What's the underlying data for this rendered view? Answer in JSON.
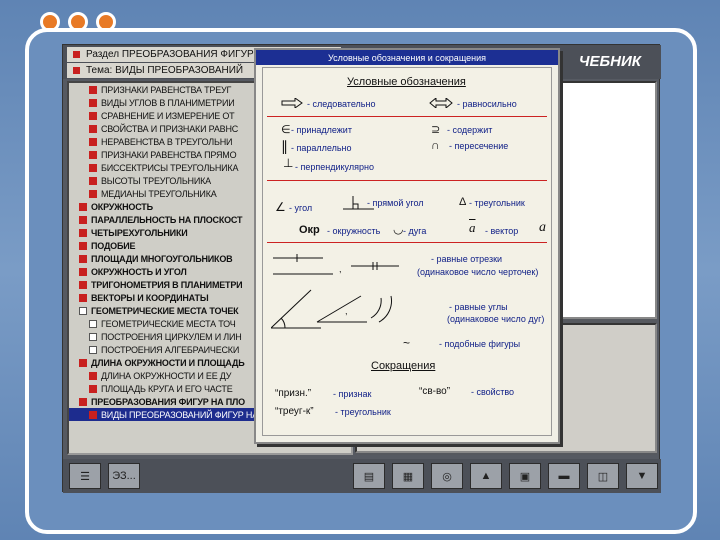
{
  "top": {
    "section_line": "Раздел ПРЕОБРАЗОВАНИЯ ФИГУР",
    "topic_line": "Тема:  ВИДЫ ПРЕОБРАЗОВАНИЙ",
    "title_right": "ЧЕБНИК"
  },
  "tree": [
    {
      "label": "ПРИЗНАКИ РАВЕНСТВА ТРЕУГ",
      "level": 1,
      "box": "red"
    },
    {
      "label": "ВИДЫ УГЛОВ В ПЛАНИМЕТРИИ",
      "level": 1,
      "box": "red"
    },
    {
      "label": "СРАВНЕНИЕ И ИЗМЕРЕНИЕ ОТ",
      "level": 1,
      "box": "red"
    },
    {
      "label": "СВОЙСТВА И ПРИЗНАКИ РАВНС",
      "level": 1,
      "box": "red"
    },
    {
      "label": "НЕРАВЕНСТВА В ТРЕУГОЛЬНИ",
      "level": 1,
      "box": "red"
    },
    {
      "label": "ПРИЗНАКИ РАВЕНСТВА ПРЯМО",
      "level": 1,
      "box": "red"
    },
    {
      "label": "БИССЕКТРИСЫ ТРЕУГОЛЬНИКА",
      "level": 1,
      "box": "red"
    },
    {
      "label": "ВЫСОТЫ ТРЕУГОЛЬНИКА",
      "level": 1,
      "box": "red"
    },
    {
      "label": "МЕДИАНЫ ТРЕУГОЛЬНИКА",
      "level": 1,
      "box": "red"
    },
    {
      "label": "ОКРУЖНОСТЬ",
      "level": 0,
      "box": "red",
      "bold": true
    },
    {
      "label": "ПАРАЛЛЕЛЬНОСТЬ НА ПЛОСКОСТ",
      "level": 0,
      "box": "red",
      "bold": true
    },
    {
      "label": "ЧЕТЫРЕХУГОЛЬНИКИ",
      "level": 0,
      "box": "red",
      "bold": true
    },
    {
      "label": "ПОДОБИЕ",
      "level": 0,
      "box": "red",
      "bold": true
    },
    {
      "label": "ПЛОЩАДИ МНОГОУГОЛЬНИКОВ",
      "level": 0,
      "box": "red",
      "bold": true
    },
    {
      "label": "ОКРУЖНОСТЬ И УГОЛ",
      "level": 0,
      "box": "red",
      "bold": true
    },
    {
      "label": "ТРИГОНОМЕТРИЯ В ПЛАНИМЕТРИ",
      "level": 0,
      "box": "red",
      "bold": true
    },
    {
      "label": "ВЕКТОРЫ И КООРДИНАТЫ",
      "level": 0,
      "box": "red",
      "bold": true
    },
    {
      "label": "ГЕОМЕТРИЧЕСКИЕ МЕСТА ТОЧЕК",
      "level": 0,
      "box": "white",
      "bold": true
    },
    {
      "label": "ГЕОМЕТРИЧЕСКИЕ МЕСТА ТОЧ",
      "level": 1,
      "box": "white"
    },
    {
      "label": "ПОСТРОЕНИЯ ЦИРКУЛЕМ И ЛИН",
      "level": 1,
      "box": "white"
    },
    {
      "label": "ПОСТРОЕНИЯ АЛГЕБРАИЧЕСКИ",
      "level": 1,
      "box": "white"
    },
    {
      "label": "ДЛИНА ОКРУЖНОСТИ И ПЛОЩАДЬ",
      "level": 0,
      "box": "red",
      "bold": true
    },
    {
      "label": "ДЛИНА ОКРУЖНОСТИ И ЕЕ ДУ",
      "level": 1,
      "box": "red"
    },
    {
      "label": "ПЛОЩАДЬ КРУГА И ЕГО ЧАСТЕ",
      "level": 1,
      "box": "red"
    },
    {
      "label": "ПРЕОБРАЗОВАНИЯ ФИГУР НА ПЛО",
      "level": 0,
      "box": "red",
      "bold": true
    },
    {
      "label": "ВИДЫ ПРЕОБРАЗОВАНИЙ ФИГУР НА ПЛОСКО",
      "level": 1,
      "box": "red",
      "selected": true
    }
  ],
  "toolbar": [
    "☰",
    "ЭЗ...",
    "▤",
    "▦",
    "◎",
    "▲",
    "▣",
    "▬",
    "◫",
    "▼"
  ],
  "dialog": {
    "title": "Условные обозначения и сокращения",
    "h1": "Условные обозначения",
    "follows": "- следовательно",
    "equivalent": "- равносильно",
    "belongs": "- принадлежит",
    "contains": "- содержит",
    "parallel": "- параллельно",
    "intersection": "- пересечение",
    "perpendicular": "- перпендикулярно",
    "angle": "- угол",
    "right_angle": "- прямой угол",
    "triangle": "- треугольник",
    "okr": "Окр",
    "circle": "- окружность",
    "arc": "- дуга",
    "a1": "a",
    "vector": "- вектор",
    "a2": "a",
    "comma1": ",",
    "eq_segments": "- равные отрезки",
    "eq_segments_note": "(одинаковое число черточек)",
    "comma2": ",",
    "eq_angles": "- равные углы",
    "eq_angles_note": "(одинаковое число дуг)",
    "similar_sym": "~",
    "similar": "- подобные фигуры",
    "h2": "Сокращения",
    "abbr1": "“призн.”",
    "abbr1_t": "- признак",
    "abbr2": "“св-во”",
    "abbr2_t": "- свойство",
    "abbr3": "“треуг-к”",
    "abbr3_t": "- треугольник"
  }
}
